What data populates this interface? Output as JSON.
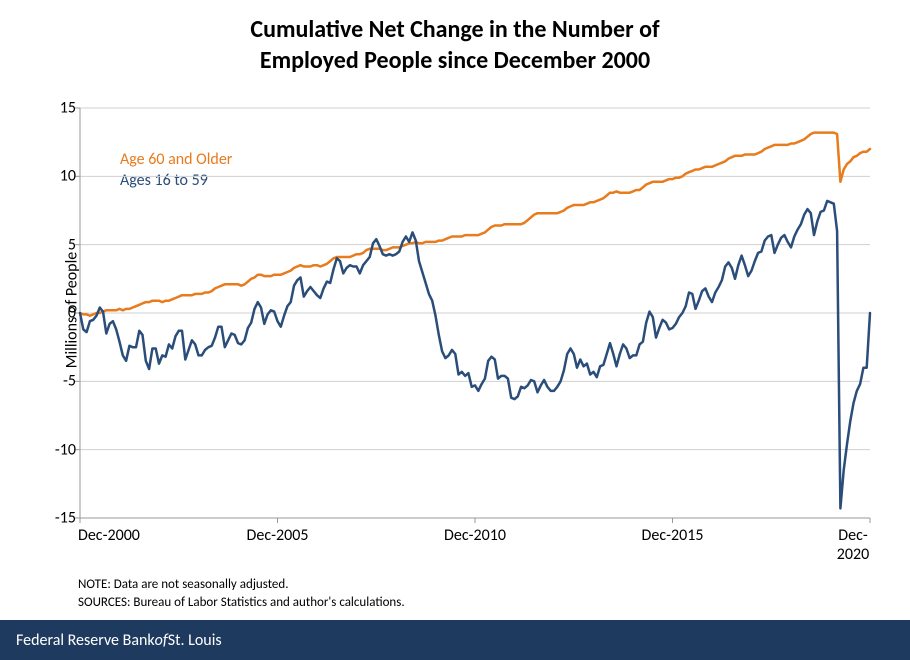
{
  "title_line1": "Cumulative Net Change in the Number of",
  "title_line2": "Employed People since December 2000",
  "ylabel": "Millions of People",
  "legend": {
    "orange": "Age 60 and Older",
    "blue": "Ages 16 to 59"
  },
  "note_line1": "NOTE: Data are not seasonally adjusted.",
  "note_line2": "SOURCES: Bureau of Labor Statistics and author's calculations.",
  "footer_prefix": "Federal Reserve Bank ",
  "footer_of": "of",
  "footer_suffix": " St. Louis",
  "chart_data": {
    "type": "line",
    "xlabel": "",
    "ylabel": "Millions of People",
    "ylim": [
      -15,
      15
    ],
    "xrange": [
      "Dec-2000",
      "Dec-2020"
    ],
    "x_ticks": [
      "Dec-2000",
      "Dec-2005",
      "Dec-2010",
      "Dec-2015",
      "Dec-2020"
    ],
    "y_ticks": [
      -15,
      -10,
      -5,
      0,
      5,
      10,
      15
    ],
    "series": [
      {
        "name": "Age 60 and Older",
        "color": "#e87b1d",
        "values": [
          0,
          -0.1,
          -0.1,
          -0.2,
          -0.1,
          0,
          0,
          0.1,
          0.2,
          0.2,
          0.2,
          0.2,
          0.3,
          0.2,
          0.3,
          0.3,
          0.4,
          0.5,
          0.6,
          0.7,
          0.8,
          0.8,
          0.9,
          0.9,
          0.9,
          0.8,
          0.9,
          0.9,
          1,
          1.1,
          1.2,
          1.3,
          1.3,
          1.3,
          1.3,
          1.4,
          1.4,
          1.4,
          1.5,
          1.5,
          1.6,
          1.8,
          1.9,
          2,
          2.1,
          2.1,
          2.1,
          2.1,
          2.1,
          2,
          2.1,
          2.3,
          2.5,
          2.6,
          2.8,
          2.8,
          2.7,
          2.7,
          2.7,
          2.8,
          2.8,
          2.8,
          2.9,
          3,
          3.1,
          3.3,
          3.4,
          3.5,
          3.4,
          3.4,
          3.4,
          3.5,
          3.5,
          3.4,
          3.5,
          3.6,
          3.8,
          4,
          4.1,
          4.1,
          4.1,
          4.1,
          4.1,
          4.2,
          4.3,
          4.3,
          4.4,
          4.6,
          4.7,
          4.7,
          4.7,
          4.7,
          4.6,
          4.6,
          4.7,
          4.8,
          4.8,
          4.8,
          4.9,
          5,
          5.1,
          5.1,
          5.2,
          5.1,
          5.1,
          5.2,
          5.2,
          5.2,
          5.2,
          5.3,
          5.3,
          5.4,
          5.5,
          5.6,
          5.6,
          5.6,
          5.6,
          5.7,
          5.7,
          5.7,
          5.7,
          5.7,
          5.8,
          5.9,
          6.1,
          6.3,
          6.4,
          6.4,
          6.4,
          6.5,
          6.5,
          6.5,
          6.5,
          6.5,
          6.5,
          6.6,
          6.8,
          7,
          7.2,
          7.3,
          7.3,
          7.3,
          7.3,
          7.3,
          7.3,
          7.3,
          7.4,
          7.5,
          7.7,
          7.8,
          7.9,
          7.9,
          7.9,
          7.9,
          8,
          8.1,
          8.1,
          8.2,
          8.3,
          8.4,
          8.6,
          8.8,
          8.8,
          8.9,
          8.8,
          8.8,
          8.8,
          8.8,
          8.9,
          9,
          9,
          9.2,
          9.4,
          9.5,
          9.6,
          9.6,
          9.6,
          9.6,
          9.7,
          9.8,
          9.8,
          9.9,
          9.9,
          10,
          10.2,
          10.3,
          10.4,
          10.5,
          10.5,
          10.6,
          10.7,
          10.7,
          10.7,
          10.8,
          10.9,
          11,
          11.1,
          11.3,
          11.4,
          11.5,
          11.5,
          11.5,
          11.6,
          11.6,
          11.6,
          11.6,
          11.7,
          11.8,
          12,
          12.1,
          12.2,
          12.3,
          12.3,
          12.3,
          12.3,
          12.3,
          12.4,
          12.4,
          12.5,
          12.6,
          12.7,
          12.9,
          13.1,
          13.2,
          13.2,
          13.2,
          13.2,
          13.2,
          13.2,
          13.2,
          13.1,
          9.6,
          10.5,
          10.9,
          11.1,
          11.4,
          11.5,
          11.7,
          11.8,
          11.8,
          12
        ]
      },
      {
        "name": "Ages 16 to 59",
        "color": "#2a4d7a",
        "values": [
          0,
          -1.2,
          -1.4,
          -0.6,
          -0.5,
          -0.2,
          0.4,
          0.1,
          -1.5,
          -0.8,
          -0.6,
          -1.2,
          -2.1,
          -3.1,
          -3.5,
          -2.4,
          -2.5,
          -2.5,
          -1.3,
          -1.6,
          -3.5,
          -4.1,
          -2.6,
          -2.6,
          -3.7,
          -3.1,
          -3.2,
          -2.3,
          -2.6,
          -1.7,
          -1.3,
          -1.3,
          -3.4,
          -2.7,
          -2,
          -2.3,
          -3.1,
          -3.1,
          -2.7,
          -2.5,
          -2.4,
          -1.8,
          -1,
          -1,
          -2.5,
          -2,
          -1.5,
          -1.6,
          -2.2,
          -2.3,
          -2,
          -1.1,
          -0.7,
          0.3,
          0.8,
          0.4,
          -0.8,
          -0.1,
          0.2,
          0.1,
          -0.6,
          -1,
          -0.2,
          0.5,
          0.8,
          2,
          2.4,
          2.6,
          1.2,
          1.6,
          1.9,
          1.6,
          1.3,
          1.1,
          1.8,
          2.3,
          2.2,
          3.2,
          4,
          3.8,
          2.9,
          3.3,
          3.5,
          3.4,
          3.4,
          2.9,
          3.5,
          3.8,
          4.1,
          5.1,
          5.4,
          4.9,
          4.3,
          4.2,
          4.3,
          4.2,
          4.3,
          4.5,
          5.2,
          5.6,
          5.2,
          5.9,
          5.3,
          3.8,
          3,
          2.2,
          1.4,
          0.9,
          -0.2,
          -1.6,
          -2.8,
          -3.3,
          -3.1,
          -2.7,
          -3,
          -4.5,
          -4.3,
          -4.6,
          -4.4,
          -5.4,
          -5.3,
          -5.7,
          -5.2,
          -4.8,
          -3.5,
          -3.2,
          -3.4,
          -4.8,
          -4.6,
          -4.6,
          -4.8,
          -6.2,
          -6.3,
          -6.1,
          -5.4,
          -5.5,
          -5.3,
          -4.9,
          -5,
          -5.8,
          -5.3,
          -4.9,
          -5.4,
          -5.7,
          -5.7,
          -5.4,
          -5,
          -4.2,
          -3,
          -2.6,
          -3,
          -4,
          -3.4,
          -3.9,
          -3.7,
          -4.5,
          -4.3,
          -4.7,
          -3.9,
          -3.8,
          -3,
          -2.2,
          -3,
          -3.9,
          -3,
          -2.3,
          -2.6,
          -3.3,
          -3.1,
          -3.1,
          -2.3,
          -2.1,
          -0.7,
          0.1,
          -0.3,
          -1.8,
          -1.1,
          -0.5,
          -0.7,
          -1.2,
          -1.1,
          -0.8,
          -0.3,
          0,
          0.5,
          1.5,
          1.4,
          0.3,
          0.9,
          1.6,
          1.8,
          1.2,
          0.8,
          1.5,
          1.9,
          2.4,
          3.4,
          3.7,
          3.3,
          2.5,
          3.5,
          4.2,
          3.5,
          2.7,
          3.1,
          3.8,
          4.4,
          4.5,
          5.3,
          5.6,
          5.7,
          4.4,
          5,
          5.5,
          5.7,
          5.2,
          4.8,
          5.6,
          6.1,
          6.5,
          7.2,
          7.6,
          7.3,
          5.7,
          6.7,
          7.4,
          7.5,
          8.2,
          8.1,
          8,
          6,
          -14.3,
          -11.5,
          -9.6,
          -7.9,
          -6.6,
          -5.7,
          -5.2,
          -4,
          -4,
          0
        ]
      }
    ]
  }
}
